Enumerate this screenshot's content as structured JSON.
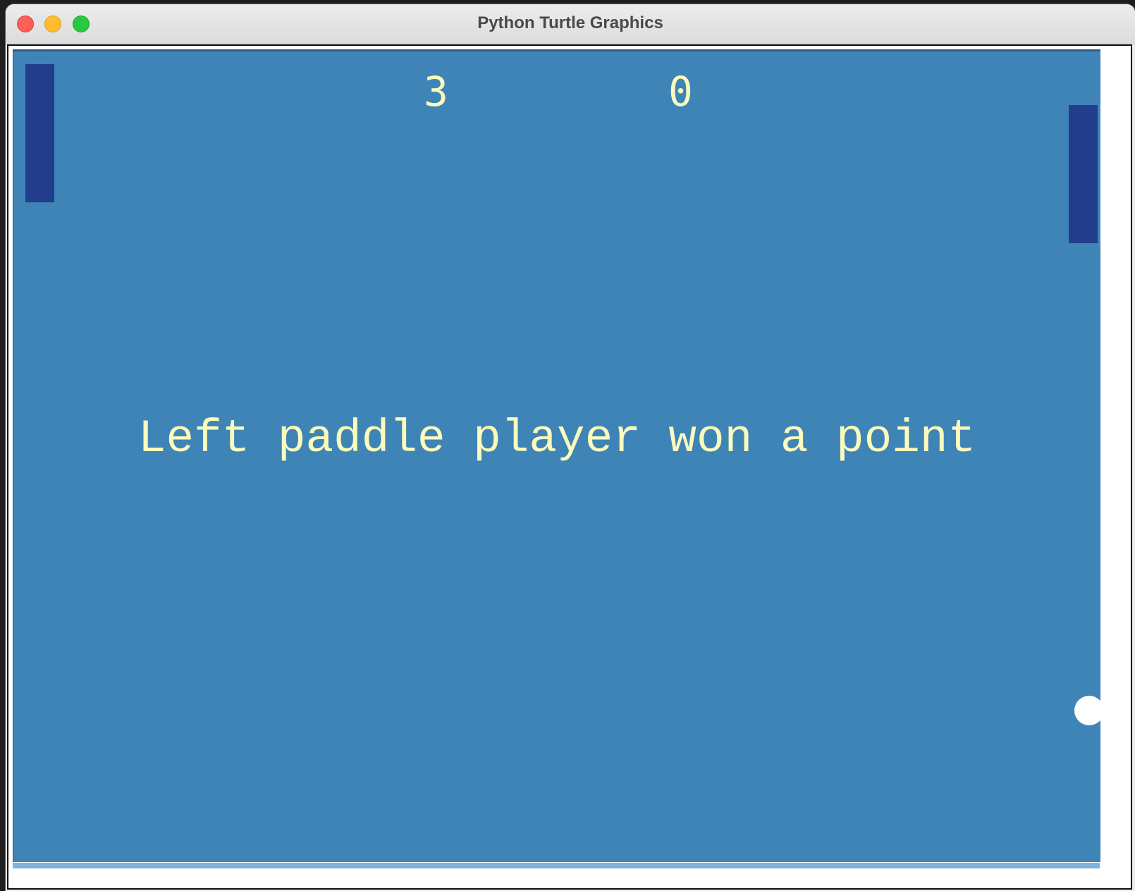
{
  "window": {
    "title": "Python Turtle Graphics"
  },
  "game": {
    "score_left": "3",
    "score_right": "0",
    "message": "Left paddle player won a point"
  },
  "colors": {
    "canvas_background": "#3f84b7",
    "paddle": "#223d8b",
    "text": "#fbfbbc",
    "ball": "#ffffff"
  }
}
